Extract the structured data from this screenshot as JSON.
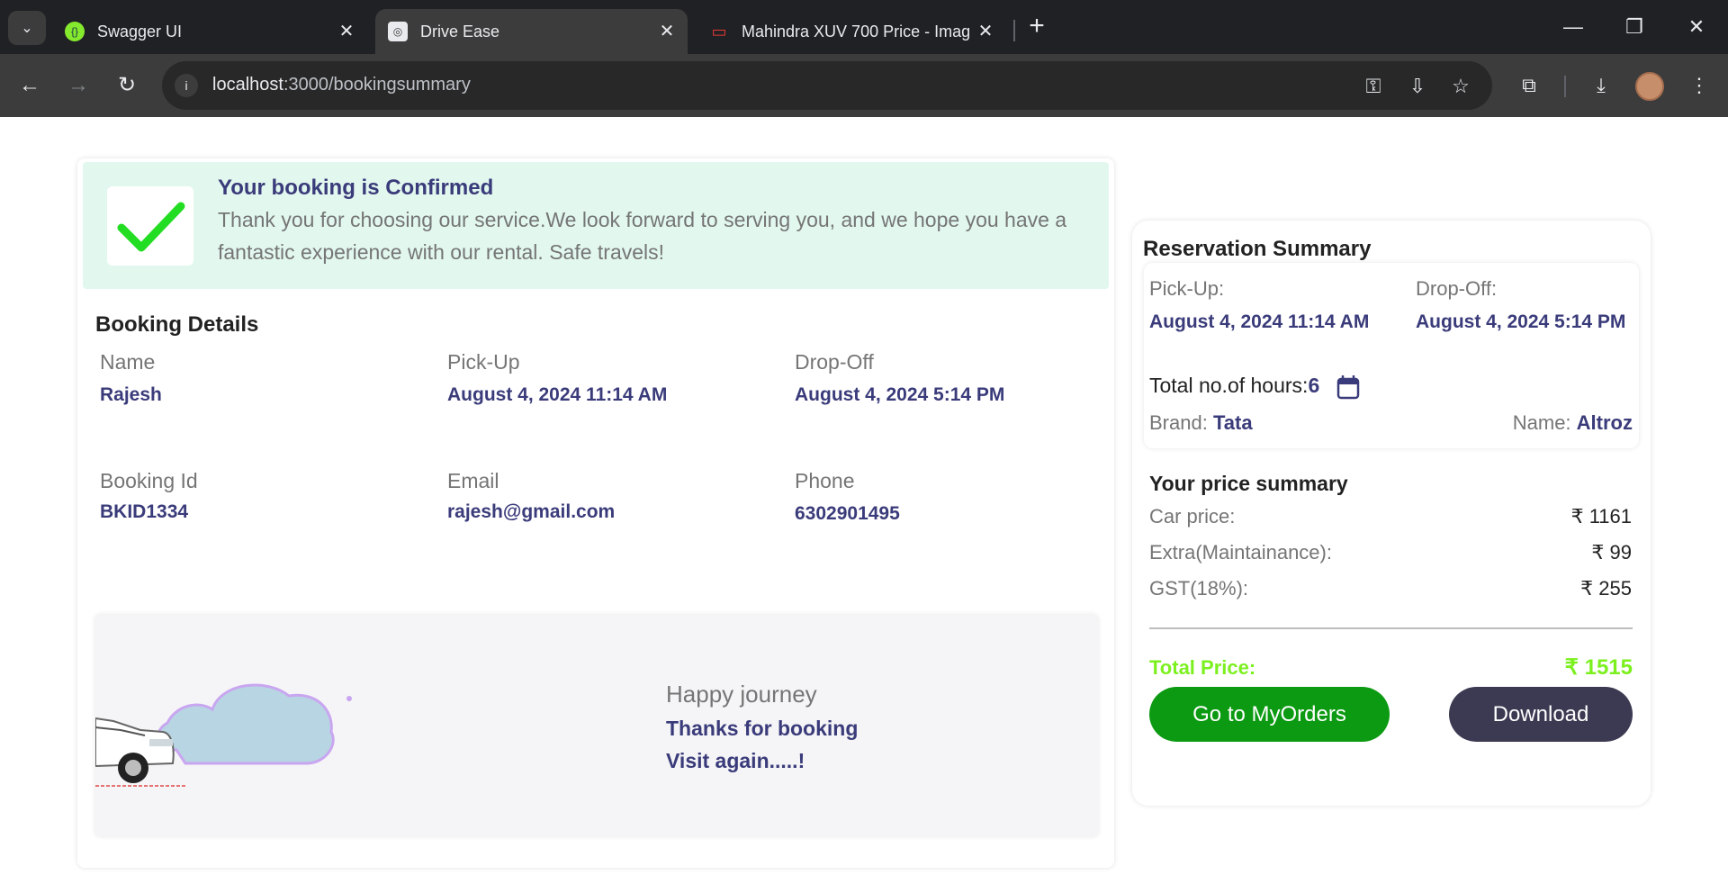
{
  "browser": {
    "tabs": [
      {
        "title": "Swagger UI",
        "icon": "swagger-icon",
        "active": false
      },
      {
        "title": "Drive Ease",
        "icon": "drive-ease-icon",
        "active": true
      },
      {
        "title": "Mahindra XUV 700 Price - Imag",
        "icon": "car-site-icon",
        "active": false
      }
    ],
    "url_host": "localhost",
    "url_path": ":3000/bookingsummary"
  },
  "confirmation": {
    "title": "Your booking is Confirmed",
    "message": "Thank you for choosing our service.We look forward to serving you, and we hope you have a fantastic experience with our rental. Safe travels!"
  },
  "booking_details": {
    "heading": "Booking Details",
    "name_label": "Name",
    "name": "Rajesh",
    "pickup_label": "Pick-Up",
    "pickup": "August 4, 2024 11:14 AM",
    "dropoff_label": "Drop-Off",
    "dropoff": "August 4, 2024 5:14 PM",
    "booking_id_label": "Booking Id",
    "booking_id": "BKID1334",
    "email_label": "Email",
    "email": "rajesh@gmail.com",
    "phone_label": "Phone",
    "phone": "6302901495"
  },
  "journey": {
    "line1": "Happy journey",
    "line2": "Thanks for booking",
    "line3": "Visit again.....!"
  },
  "reservation": {
    "heading": "Reservation Summary",
    "pickup_label": "Pick-Up:",
    "pickup": "August 4, 2024 11:14 AM",
    "dropoff_label": "Drop-Off:",
    "dropoff": "August 4, 2024 5:14 PM",
    "hours_label": "Total no.of hours:",
    "hours": "6",
    "brand_label": "Brand:",
    "brand": "Tata",
    "car_name_label": "Name:",
    "car_name": "Altroz"
  },
  "price_summary": {
    "heading": "Your price summary",
    "car_price_label": "Car price:",
    "car_price": "₹ 1161",
    "extra_label": "Extra(Maintainance):",
    "extra": "₹ 99",
    "gst_label": "GST(18%):",
    "gst": "₹ 255",
    "total_label": "Total Price:",
    "total": "₹ 1515"
  },
  "actions": {
    "orders_label": "Go to MyOrders",
    "download_label": "Download"
  },
  "colors": {
    "accent_navy": "#3a3b7a",
    "confirm_bg": "#e2f8ee",
    "check_green": "#22dd22",
    "total_green": "#7cf01f",
    "orders_button": "#0c9a12",
    "download_button": "#3b3a52"
  }
}
